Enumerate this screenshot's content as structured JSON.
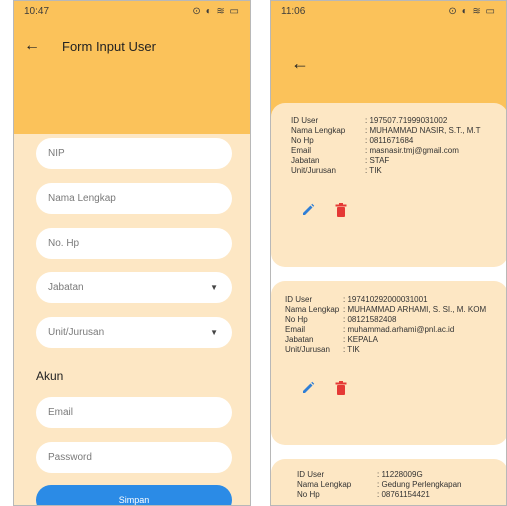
{
  "left_screen": {
    "status_time": "10:47",
    "status_icons": "⊙ ◐ ≋ ▭",
    "title": "Form Input User",
    "fields": {
      "nip": "NIP",
      "nama": "Nama Lengkap",
      "hp": "No. Hp",
      "jabatan": "Jabatan",
      "unit": "Unit/Jurusan",
      "email": "Email",
      "password": "Password"
    },
    "section_akun": "Akun",
    "submit_label": "Simpan"
  },
  "right_screen": {
    "status_time": "11:06",
    "status_icons": "⊙ ◐ ≋ ▭",
    "labels": {
      "id": "ID User",
      "nama": "Nama Lengkap",
      "hp": "No Hp",
      "email": "Email",
      "jabatan": "Jabatan",
      "unit": "Unit/Jurusan"
    },
    "users": [
      {
        "id": ": 197507.71999031002",
        "nama": ": MUHAMMAD NASIR, S.T., M.T",
        "hp": ": 0811671684",
        "email": ": masnasir.tmj@gmail.com",
        "jabatan": ": STAF",
        "unit": ": TIK"
      },
      {
        "id": ": 197410292000031001",
        "nama": ": MUHAMMAD ARHAMI, S. SI., M. KOM",
        "hp": ": 08121582408",
        "email": ": muhammad.arhami@pnl.ac.id",
        "jabatan": ": KEPALA",
        "unit": ": TIK"
      },
      {
        "id": ": 11228009G",
        "nama": ": Gedung Perlengkapan",
        "hp": ": 08761154421"
      }
    ]
  },
  "colors": {
    "header": "#fbc25a",
    "background": "#fde7c4",
    "edit_icon": "#2f7fd6",
    "delete_icon": "#e53935",
    "submit": "#2b8be6"
  }
}
